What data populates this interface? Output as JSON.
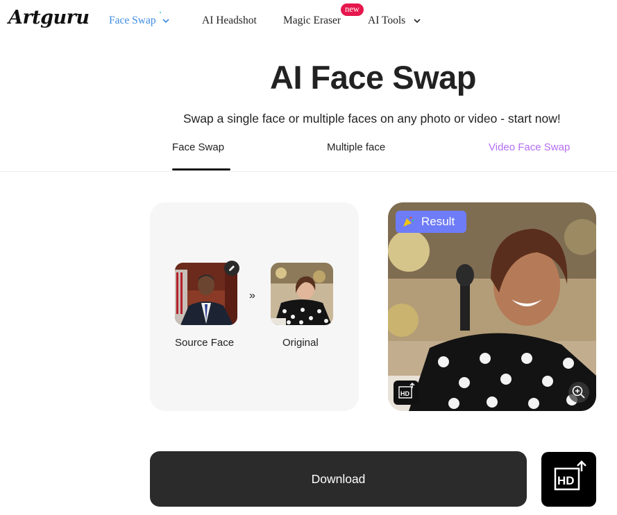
{
  "header": {
    "logo": "Artguru",
    "nav": [
      {
        "label": "Face Swap",
        "active": true,
        "dropdown": true
      },
      {
        "label": "AI Headshot",
        "active": false,
        "dropdown": false
      },
      {
        "label": "Magic Eraser",
        "active": false,
        "dropdown": false,
        "badge": "new"
      },
      {
        "label": "AI Tools",
        "active": false,
        "dropdown": true
      }
    ]
  },
  "hero": {
    "title": "AI Face Swap",
    "subtitle": "Swap a single face or multiple faces on any photo or video - start now!"
  },
  "tabs": [
    {
      "label": "Face Swap",
      "active": true
    },
    {
      "label": "Multiple face",
      "active": false
    },
    {
      "label": "Video Face Swap",
      "active": false
    }
  ],
  "inputs": {
    "source_label": "Source Face",
    "original_label": "Original",
    "arrow": "»"
  },
  "result": {
    "badge": "Result",
    "result_icon": "party-icon",
    "hd_icon": "hd-upscale-icon",
    "zoom_icon": "zoom-in-icon"
  },
  "actions": {
    "download_label": "Download",
    "hd_icon": "hd-upscale-icon"
  },
  "colors": {
    "active_nav": "#3d8be0",
    "badge_new": "#e6174d",
    "video_tab": "#b46df2",
    "result_badge": "#6f7cf7",
    "download_bg": "#2b2b2b"
  }
}
